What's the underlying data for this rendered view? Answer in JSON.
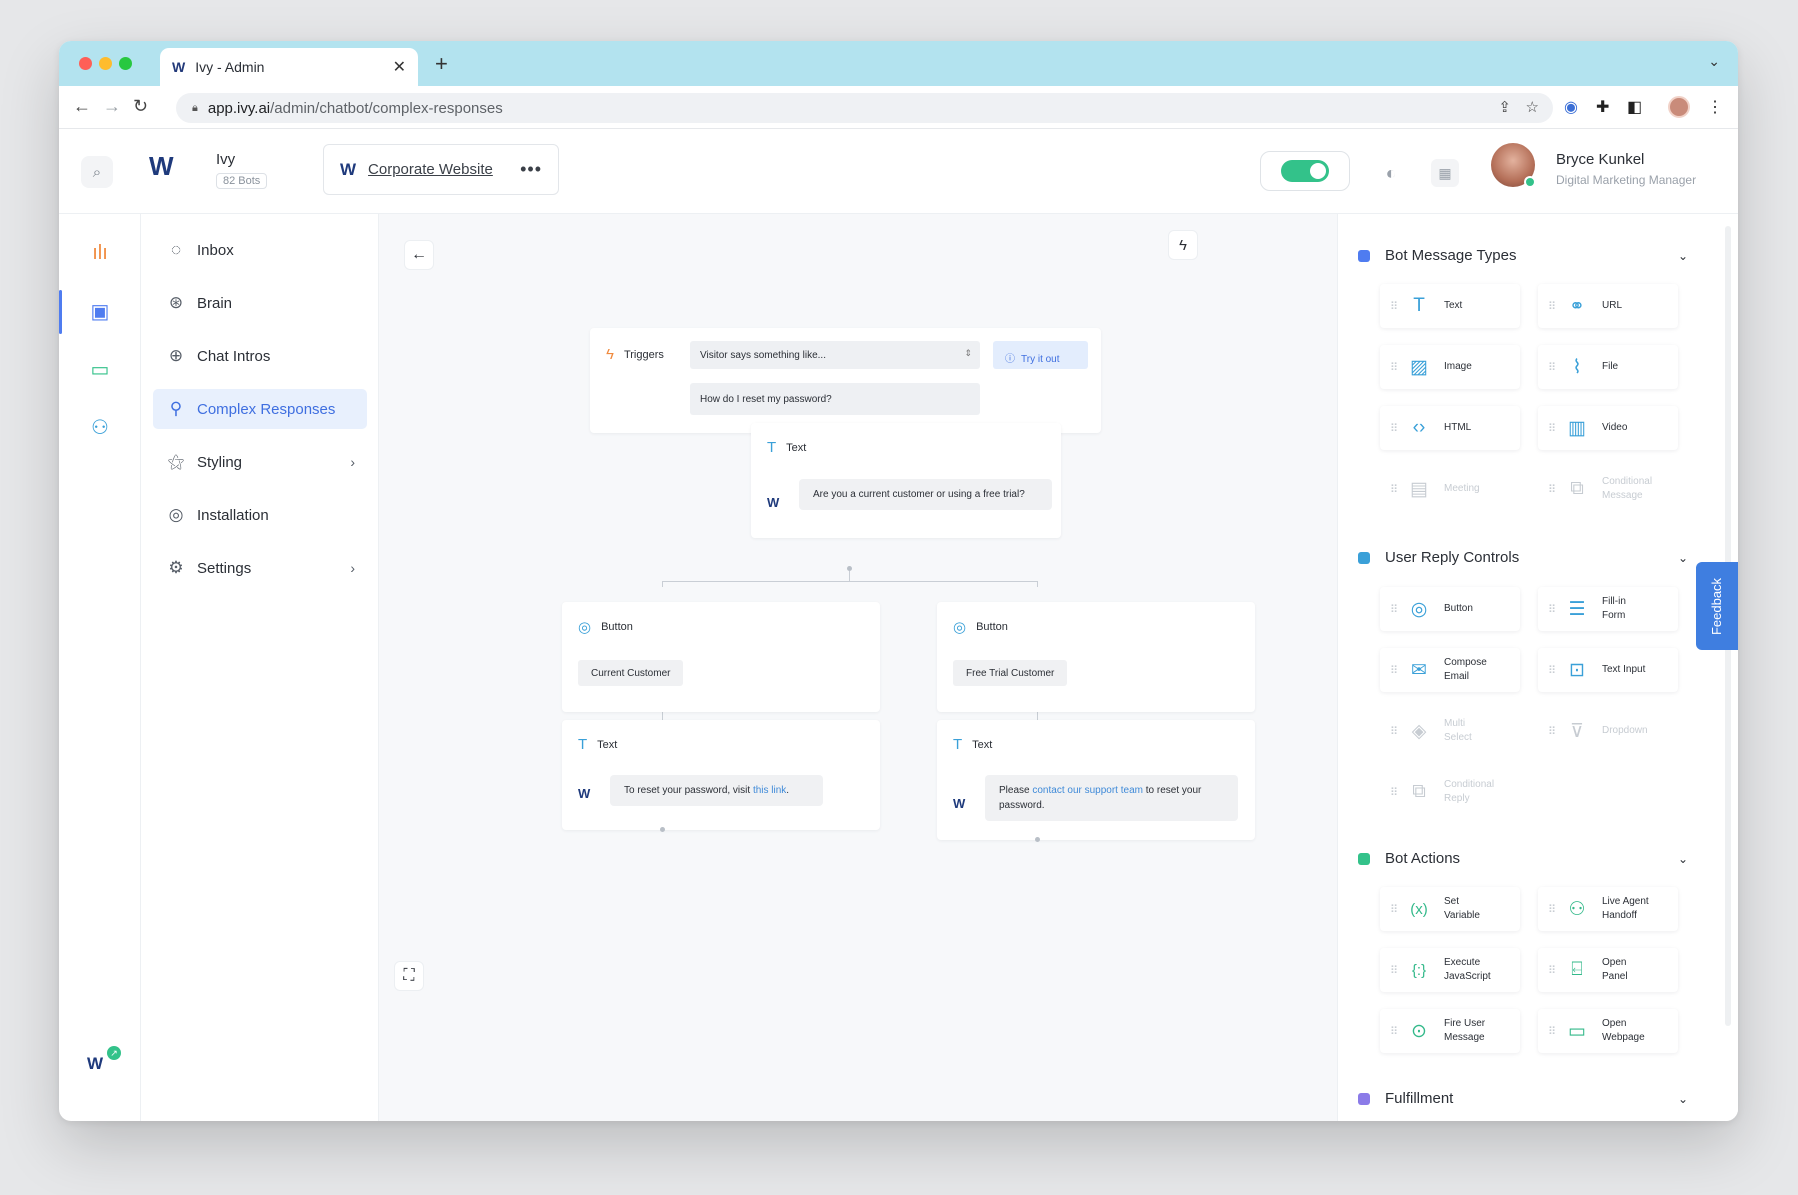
{
  "browser": {
    "tab_title": "Ivy - Admin",
    "url_host": "app.ivy.ai",
    "url_path": "/admin/chatbot/complex-responses"
  },
  "header": {
    "brand_name": "Ivy",
    "bots_count": "82 Bots",
    "site_name": "Corporate Website",
    "user_name": "Bryce Kunkel",
    "user_role": "Digital Marketing Manager",
    "toggle_on": true
  },
  "sidenav": {
    "items": [
      {
        "label": "Inbox",
        "icon": "inbox-icon"
      },
      {
        "label": "Brain",
        "icon": "brain-icon"
      },
      {
        "label": "Chat Intros",
        "icon": "chat-intros-icon"
      },
      {
        "label": "Complex Responses",
        "icon": "flow-icon",
        "active": true
      },
      {
        "label": "Styling",
        "icon": "wand-icon",
        "chevron": true
      },
      {
        "label": "Installation",
        "icon": "code-icon"
      },
      {
        "label": "Settings",
        "icon": "gear-icon",
        "chevron": true
      }
    ]
  },
  "flow": {
    "trigger": {
      "label": "Triggers",
      "select_value": "Visitor says something like...",
      "try_label": "Try it out",
      "phrase": "How do I reset my password?"
    },
    "text_node": {
      "label": "Text",
      "message": "Are you a current customer or using a free trial?"
    },
    "left_button": {
      "label": "Button",
      "chip": "Current Customer"
    },
    "right_button": {
      "label": "Button",
      "chip": "Free Trial Customer"
    },
    "left_text": {
      "label": "Text",
      "msg_pre": "To reset your password, visit ",
      "msg_link": "this link",
      "msg_post": "."
    },
    "right_text": {
      "label": "Text",
      "msg_pre": "Please ",
      "msg_link": "contact our support team",
      "msg_post": " to reset your password."
    }
  },
  "panel": {
    "sections": [
      {
        "title": "Bot Message Types",
        "color": "#4f7cf0"
      },
      {
        "title": "User Reply Controls",
        "color": "#3aa0d8"
      },
      {
        "title": "Bot Actions",
        "color": "#33c28a"
      },
      {
        "title": "Fulfillment",
        "color": "#8b7be8"
      }
    ],
    "message_types": [
      {
        "label": "Text",
        "icon": "text-icon"
      },
      {
        "label": "URL",
        "icon": "link-icon"
      },
      {
        "label": "Image",
        "icon": "image-icon"
      },
      {
        "label": "File",
        "icon": "paperclip-icon"
      },
      {
        "label": "HTML",
        "icon": "code-icon"
      },
      {
        "label": "Video",
        "icon": "film-icon"
      },
      {
        "label": "Meeting",
        "icon": "calendar-icon",
        "disabled": true
      },
      {
        "label": "Conditional Message",
        "icon": "conditional-icon",
        "disabled": true
      }
    ],
    "reply_controls": [
      {
        "label": "Button",
        "icon": "cursor-click-icon"
      },
      {
        "label": "Fill-in Form",
        "icon": "lines-icon"
      },
      {
        "label": "Compose Email",
        "icon": "mail-icon"
      },
      {
        "label": "Text Input",
        "icon": "text-input-icon"
      },
      {
        "label": "Multi Select",
        "icon": "layers-icon",
        "disabled": true
      },
      {
        "label": "Dropdown",
        "icon": "dropdown-icon",
        "disabled": true
      },
      {
        "label": "Conditional Reply",
        "icon": "conditional-icon",
        "disabled": true
      }
    ],
    "bot_actions": [
      {
        "label": "Set Variable",
        "icon": "variable-icon"
      },
      {
        "label": "Live Agent Handoff",
        "icon": "agents-icon"
      },
      {
        "label": "Execute JavaScript",
        "icon": "script-icon"
      },
      {
        "label": "Open Panel",
        "icon": "panel-icon"
      },
      {
        "label": "Fire User Message",
        "icon": "fire-icon"
      },
      {
        "label": "Open Webpage",
        "icon": "webpage-icon"
      }
    ]
  },
  "feedback_label": "Feedback"
}
